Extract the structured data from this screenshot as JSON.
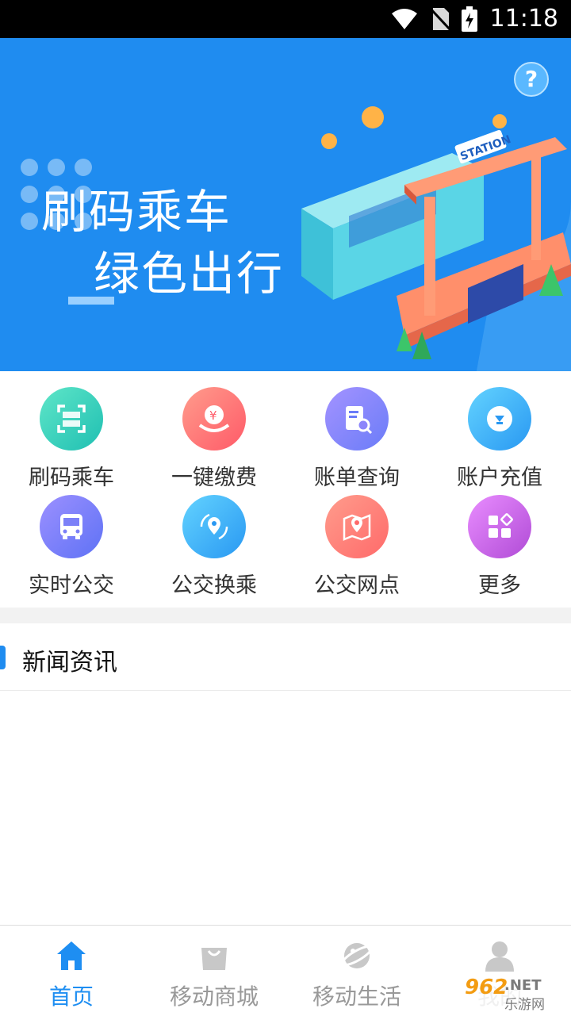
{
  "status": {
    "time": "11:18"
  },
  "banner": {
    "line1": "刷码乘车",
    "line2": "绿色出行",
    "sign": "STATION",
    "help": "?"
  },
  "services": [
    {
      "label": "刷码乘车",
      "icon": "scan-code-icon",
      "color_from": "#4fe3c1",
      "color_to": "#22c1b4"
    },
    {
      "label": "一键缴费",
      "icon": "pay-icon",
      "color_from": "#ff9a8b",
      "color_to": "#ff5f6d"
    },
    {
      "label": "账单查询",
      "icon": "bill-search-icon",
      "color_from": "#a18cff",
      "color_to": "#6a7dfb"
    },
    {
      "label": "账户充值",
      "icon": "recharge-icon",
      "color_from": "#5fd0ff",
      "color_to": "#2b9af3"
    },
    {
      "label": "实时公交",
      "icon": "bus-icon",
      "color_from": "#9a8cff",
      "color_to": "#5f73f6"
    },
    {
      "label": "公交换乘",
      "icon": "transfer-icon",
      "color_from": "#5fd0ff",
      "color_to": "#2b9af3"
    },
    {
      "label": "公交网点",
      "icon": "map-pin-icon",
      "color_from": "#ff9a8b",
      "color_to": "#ff6b6b"
    },
    {
      "label": "更多",
      "icon": "more-apps-icon",
      "color_from": "#e98cff",
      "color_to": "#b24ad8"
    }
  ],
  "news": {
    "title": "新闻资讯"
  },
  "tabs": [
    {
      "label": "首页",
      "icon": "home-icon",
      "active": true
    },
    {
      "label": "移动商城",
      "icon": "shopping-bag-icon",
      "active": false
    },
    {
      "label": "移动生活",
      "icon": "planet-icon",
      "active": false
    },
    {
      "label": "我的",
      "icon": "user-icon",
      "active": false
    }
  ],
  "watermark": {
    "brand": "962",
    "site": ".NET",
    "cn": "乐游网"
  },
  "colors": {
    "primary": "#1e8ef2",
    "banner": "#1f8cf0"
  }
}
